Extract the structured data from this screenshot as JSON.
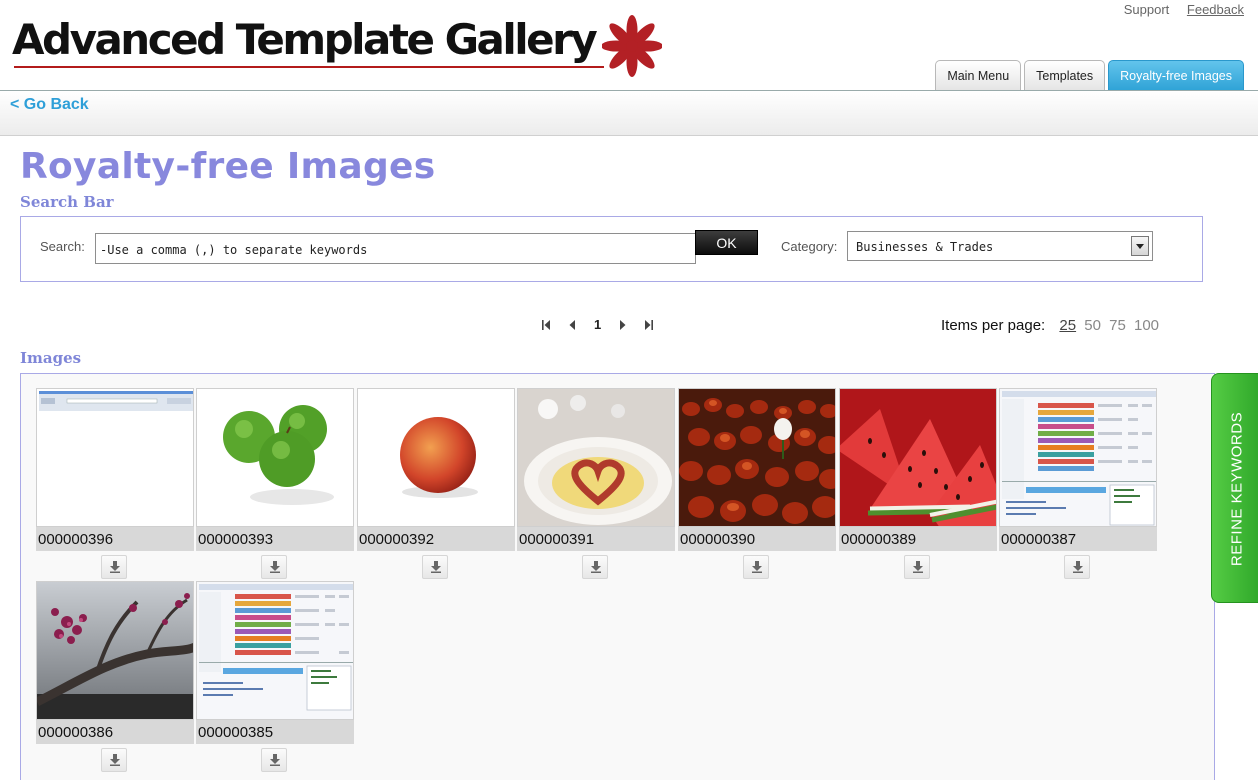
{
  "header": {
    "logo_text": "Advanced Template Gallery",
    "links": {
      "support": "Support",
      "feedback": "Feedback"
    },
    "tabs": [
      {
        "label": "Main Menu",
        "active": false
      },
      {
        "label": "Templates",
        "active": false
      },
      {
        "label": "Royalty-free Images",
        "active": true
      }
    ]
  },
  "nav": {
    "go_back": "< Go Back"
  },
  "page": {
    "title": "Royalty-free Images"
  },
  "search": {
    "section_label": "Search Bar",
    "search_label": "Search:",
    "search_value": "-Use a comma (,) to separate keywords",
    "ok_label": "OK",
    "category_label": "Category:",
    "category_value": "Businesses & Trades"
  },
  "pagination": {
    "current_page": "1",
    "items_per_page_label": "Items per page:",
    "per_page_options": [
      "25",
      "50",
      "75",
      "100"
    ],
    "selected_per_page": "25"
  },
  "images": {
    "section_label": "Images",
    "items": [
      {
        "id": "000000396",
        "subject": "screenshot-partial"
      },
      {
        "id": "000000393",
        "subject": "green-apples"
      },
      {
        "id": "000000392",
        "subject": "peach"
      },
      {
        "id": "000000391",
        "subject": "heart-dessert-plate"
      },
      {
        "id": "000000390",
        "subject": "red-tulip-field"
      },
      {
        "id": "000000389",
        "subject": "watermelon-slices"
      },
      {
        "id": "000000387",
        "subject": "spreadsheet-screenshot"
      },
      {
        "id": "000000386",
        "subject": "blossom-branch"
      },
      {
        "id": "000000385",
        "subject": "spreadsheet-screenshot"
      }
    ]
  },
  "sidebar_tab": {
    "label": "REFINE KEYWORDS"
  },
  "colors": {
    "accent": "#8888dd",
    "link": "#2e9fd8",
    "refine_green": "#3cb833",
    "active_tab": "#2ea2d6"
  }
}
